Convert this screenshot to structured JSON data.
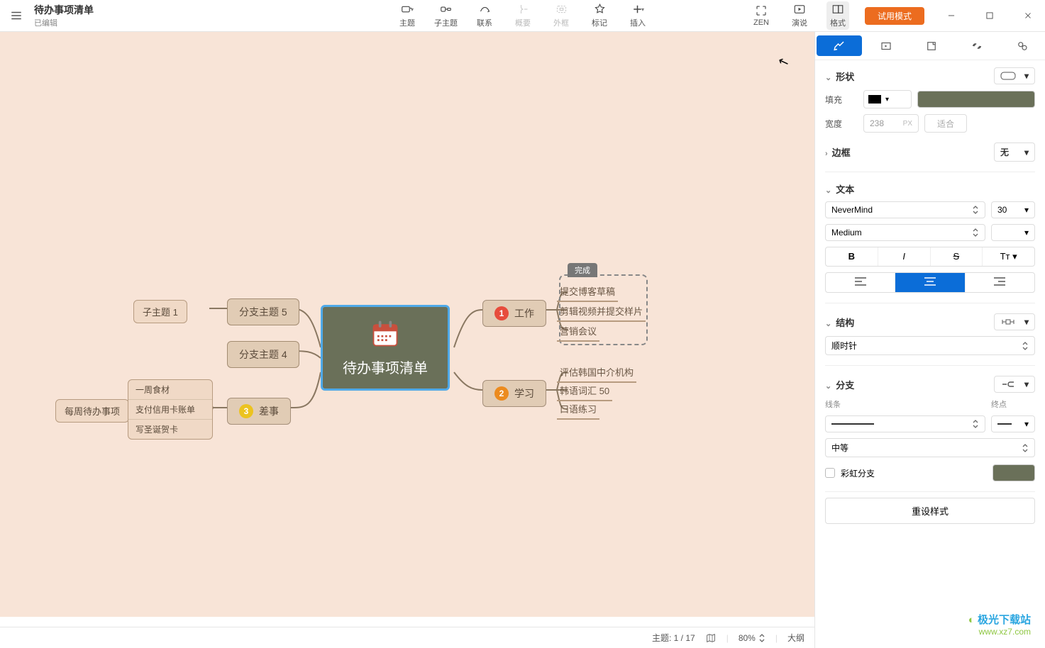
{
  "header": {
    "title": "待办事项清单",
    "subtitle": "已编辑",
    "toolbar": {
      "topic": "主题",
      "subtopic": "子主题",
      "relation": "联系",
      "summary": "概要",
      "boundary": "外框",
      "marker": "标记",
      "insert": "插入",
      "zen": "ZEN",
      "present": "演说",
      "format": "格式"
    },
    "trial": "试用模式"
  },
  "canvas": {
    "center": "待办事项清单",
    "boundary_label": "完成",
    "left": {
      "subtopic1": "子主题 1",
      "weekly": "每周待办事项",
      "branch5": "分支主题 5",
      "branch4": "分支主题 4",
      "errand": "差事",
      "weekly_items": [
        "一周食材",
        "支付信用卡账单",
        "写圣诞贺卡"
      ]
    },
    "right": {
      "work": "工作",
      "work_items": [
        "提交博客草稿",
        "剪辑视频并提交样片",
        "营销会议"
      ],
      "study": "学习",
      "study_items": [
        "评估韩国中介机构",
        "韩语词汇 50",
        "口语练习"
      ]
    }
  },
  "status": {
    "topic_label": "主题:",
    "topic_count": "1 / 17",
    "zoom": "80%",
    "outline": "大纲"
  },
  "panel": {
    "shape": "形状",
    "fill": "填充",
    "width": "宽度",
    "width_val": "238",
    "width_unit": "PX",
    "fit": "适合",
    "border": "边框",
    "border_val": "无",
    "text": "文本",
    "font": "NeverMind",
    "size": "30",
    "weight": "Medium",
    "structure": "结构",
    "struct_dir": "顺时针",
    "branch": "分支",
    "line": "线条",
    "endpoint": "终点",
    "thickness": "中等",
    "rainbow": "彩虹分支",
    "reset": "重设样式"
  },
  "watermark": {
    "l1": "极光下载站",
    "l2": "www.xz7.com"
  }
}
